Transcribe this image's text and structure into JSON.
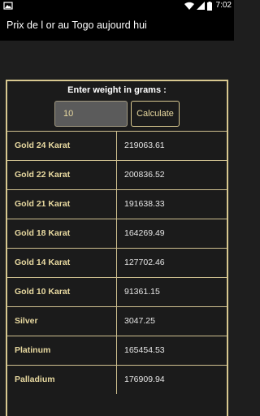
{
  "status_bar": {
    "time": "7:02",
    "icons": [
      "photo-icon",
      "wifi-icon",
      "signal-icon",
      "battery-icon"
    ]
  },
  "app_bar": {
    "title": "Prix de l or au Togo aujourd hui"
  },
  "form": {
    "prompt": "Enter weight in grams :",
    "weight_value": "10",
    "calculate_label": "Calculate"
  },
  "rows": [
    {
      "label": "Gold 24 Karat",
      "value": "219063.61"
    },
    {
      "label": "Gold 22 Karat",
      "value": "200836.52"
    },
    {
      "label": "Gold 21 Karat",
      "value": "191638.33"
    },
    {
      "label": "Gold 18 Karat",
      "value": "164269.49"
    },
    {
      "label": "Gold 14 Karat",
      "value": "127702.46"
    },
    {
      "label": "Gold 10 Karat",
      "value": "91361.15"
    },
    {
      "label": "Silver",
      "value": "3047.25"
    },
    {
      "label": "Platinum",
      "value": "165454.53"
    },
    {
      "label": "Palladium",
      "value": "176909.94"
    }
  ],
  "colors": {
    "accent": "#d8c890",
    "label_text": "#e8d9a0",
    "background": "#1e1e1e"
  }
}
